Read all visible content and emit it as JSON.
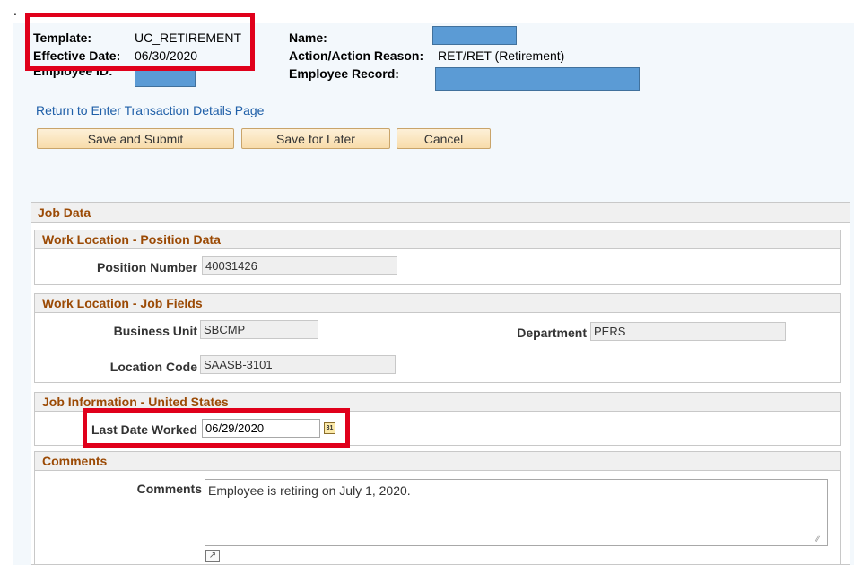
{
  "header": {
    "template_label": "Template:",
    "template_value": "UC_RETIREMENT",
    "effective_date_label": "Effective Date:",
    "effective_date_value": "06/30/2020",
    "employee_id_label": "Employee ID:",
    "name_label": "Name:",
    "action_reason_label": "Action/Action Reason:",
    "action_reason_value": "RET/RET (Retirement)",
    "employee_record_label": "Employee Record:"
  },
  "return_link": "Return to Enter Transaction Details Page",
  "buttons": {
    "save_submit": "Save and Submit",
    "save_later": "Save for Later",
    "cancel": "Cancel"
  },
  "job_data": {
    "title": "Job Data",
    "position_section": {
      "title": "Work Location - Position Data",
      "position_number_label": "Position Number",
      "position_number_value": "40031426"
    },
    "job_fields_section": {
      "title": "Work Location - Job Fields",
      "business_unit_label": "Business Unit",
      "business_unit_value": "SBCMP",
      "department_label": "Department",
      "department_value": "PERS",
      "location_code_label": "Location Code",
      "location_code_value": "SAASB-3101"
    },
    "job_info_section": {
      "title": "Job Information - United States",
      "last_date_worked_label": "Last Date Worked",
      "last_date_worked_value": "06/29/2020",
      "calendar_icon_text": "31"
    }
  },
  "comments": {
    "title": "Comments",
    "label": "Comments",
    "value": "Employee is retiring on July 1, 2020."
  },
  "icons": {
    "calendar": "calendar-icon",
    "expand": "expand-icon",
    "resize": "resize-grip-icon"
  },
  "colors": {
    "section_title": "#9b4a05",
    "link": "#1f5fa8",
    "highlight_box": "#e0001b",
    "redaction": "#5b9bd5"
  }
}
